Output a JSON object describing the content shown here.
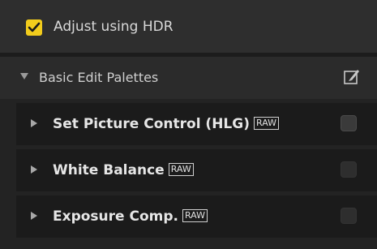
{
  "hdr": {
    "label": "Adjust using HDR",
    "checked": true,
    "accent": "#f2cc1c"
  },
  "group": {
    "label": "Basic Edit Palettes",
    "expanded": true,
    "icon": "edit-palette-icon"
  },
  "palettes": [
    {
      "label": "Set Picture Control (HLG)",
      "badge": "RAW",
      "checked": false,
      "expanded": false
    },
    {
      "label": "White Balance",
      "badge": "RAW",
      "checked": false,
      "expanded": false
    },
    {
      "label": "Exposure Comp.",
      "badge": "RAW",
      "checked": false,
      "expanded": false
    }
  ]
}
